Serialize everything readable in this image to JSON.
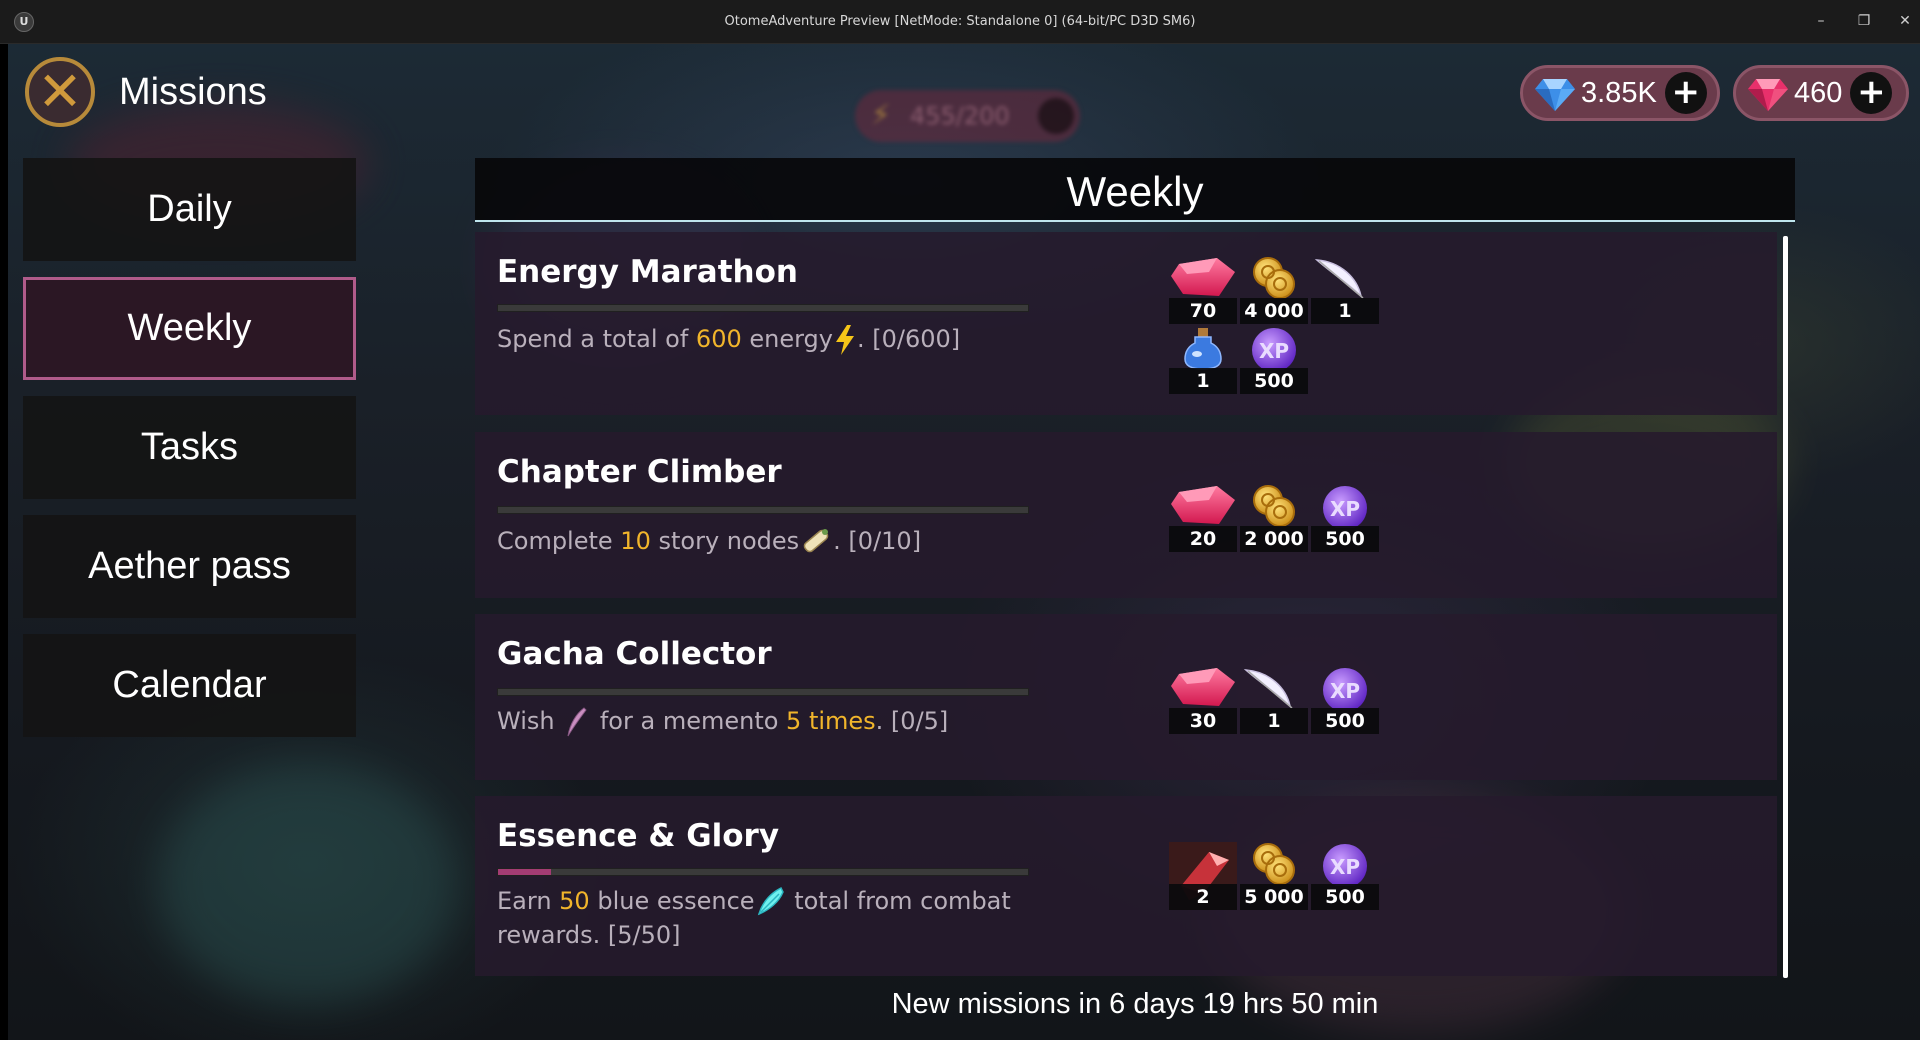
{
  "window": {
    "title": "OtomeAdventure Preview [NetMode: Standalone 0]  (64-bit/PC D3D SM6)",
    "controls": {
      "minimize": "–",
      "restore": "❐",
      "close": "✕"
    }
  },
  "header": {
    "page_title": "Missions",
    "close_icon": "close-x-icon",
    "currencies": [
      {
        "name": "diamonds",
        "amount": "3.85K",
        "icon": "blue-diamond-icon",
        "color": "#4aa3ff"
      },
      {
        "name": "gems",
        "amount": "460",
        "icon": "ruby-gem-icon",
        "color": "#e8306b"
      }
    ]
  },
  "sidebar": {
    "tabs": [
      {
        "label": "Daily",
        "active": false
      },
      {
        "label": "Weekly",
        "active": true
      },
      {
        "label": "Tasks",
        "active": false
      },
      {
        "label": "Aether pass",
        "active": false
      },
      {
        "label": "Calendar",
        "active": false
      }
    ]
  },
  "panel": {
    "title": "Weekly",
    "missions": [
      {
        "title": "Energy Marathon",
        "progress": 0.0,
        "desc": {
          "pre": "Spend a total of ",
          "hl": "600",
          "mid": " energy",
          "icon": "lightning-icon",
          "post": ". [0/600]"
        },
        "rewards": [
          {
            "icon": "ruby-gem-icon",
            "qty": "70"
          },
          {
            "icon": "gold-coins-icon",
            "qty": "4 000"
          },
          {
            "icon": "white-feather-icon",
            "qty": "1"
          },
          {
            "icon": "blue-potion-icon",
            "qty": "1"
          },
          {
            "icon": "xp-orb-icon",
            "qty": "500"
          }
        ]
      },
      {
        "title": "Chapter Climber",
        "progress": 0.0,
        "desc": {
          "pre": "Complete ",
          "hl": "10",
          "mid": " story nodes",
          "icon": "scroll-icon",
          "post": ". [0/10]"
        },
        "rewards": [
          {
            "icon": "ruby-gem-icon",
            "qty": "20"
          },
          {
            "icon": "gold-coins-icon",
            "qty": "2 000"
          },
          {
            "icon": "xp-orb-icon",
            "qty": "500"
          }
        ]
      },
      {
        "title": "Gacha Collector",
        "progress": 0.0,
        "desc": {
          "pre": "Wish ",
          "icon": "quill-icon",
          "mid": " for a memento ",
          "hl": "5 times",
          "post": ". [0/5]"
        },
        "rewards": [
          {
            "icon": "ruby-gem-icon",
            "qty": "30"
          },
          {
            "icon": "white-feather-icon",
            "qty": "1"
          },
          {
            "icon": "xp-orb-icon",
            "qty": "500"
          }
        ]
      },
      {
        "title": "Essence & Glory",
        "progress": 0.1,
        "desc": {
          "pre": "Earn ",
          "hl": "50",
          "mid": " blue essence",
          "icon": "blue-essence-icon",
          "post": " total from combat rewards. [5/50]"
        },
        "rewards": [
          {
            "icon": "red-crystal-icon",
            "qty": "2"
          },
          {
            "icon": "gold-coins-icon",
            "qty": "5 000"
          },
          {
            "icon": "xp-orb-icon",
            "qty": "500"
          }
        ]
      }
    ],
    "footer": "New missions in 6 days 19 hrs 50 min"
  },
  "background": {
    "energy_pill_text": "455/200"
  }
}
